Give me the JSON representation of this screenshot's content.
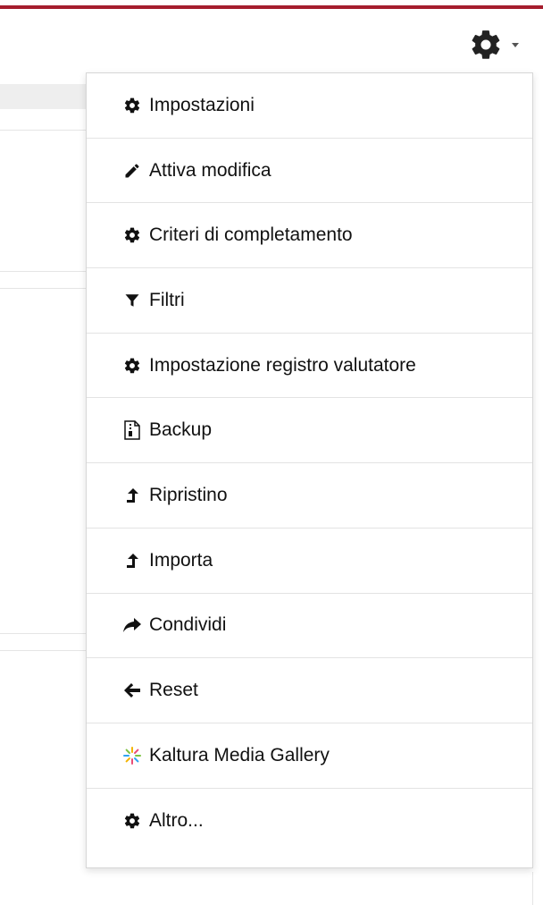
{
  "menu": {
    "items": [
      {
        "label": "Impostazioni",
        "icon": "gear-icon"
      },
      {
        "label": "Attiva modifica",
        "icon": "pencil-icon"
      },
      {
        "label": "Criteri di completamento",
        "icon": "gear-icon"
      },
      {
        "label": "Filtri",
        "icon": "filter-icon"
      },
      {
        "label": "Impostazione registro valutatore",
        "icon": "gear-icon"
      },
      {
        "label": "Backup",
        "icon": "archive-file-icon"
      },
      {
        "label": "Ripristino",
        "icon": "upload-arrow-icon"
      },
      {
        "label": "Importa",
        "icon": "upload-arrow-icon"
      },
      {
        "label": "Condividi",
        "icon": "share-icon"
      },
      {
        "label": "Reset",
        "icon": "arrow-left-icon"
      },
      {
        "label": "Kaltura Media Gallery",
        "icon": "kaltura-icon"
      },
      {
        "label": "Altro...",
        "icon": "gear-icon"
      }
    ]
  },
  "colors": {
    "accent_bar": "#a51d2d",
    "text": "#111111"
  }
}
